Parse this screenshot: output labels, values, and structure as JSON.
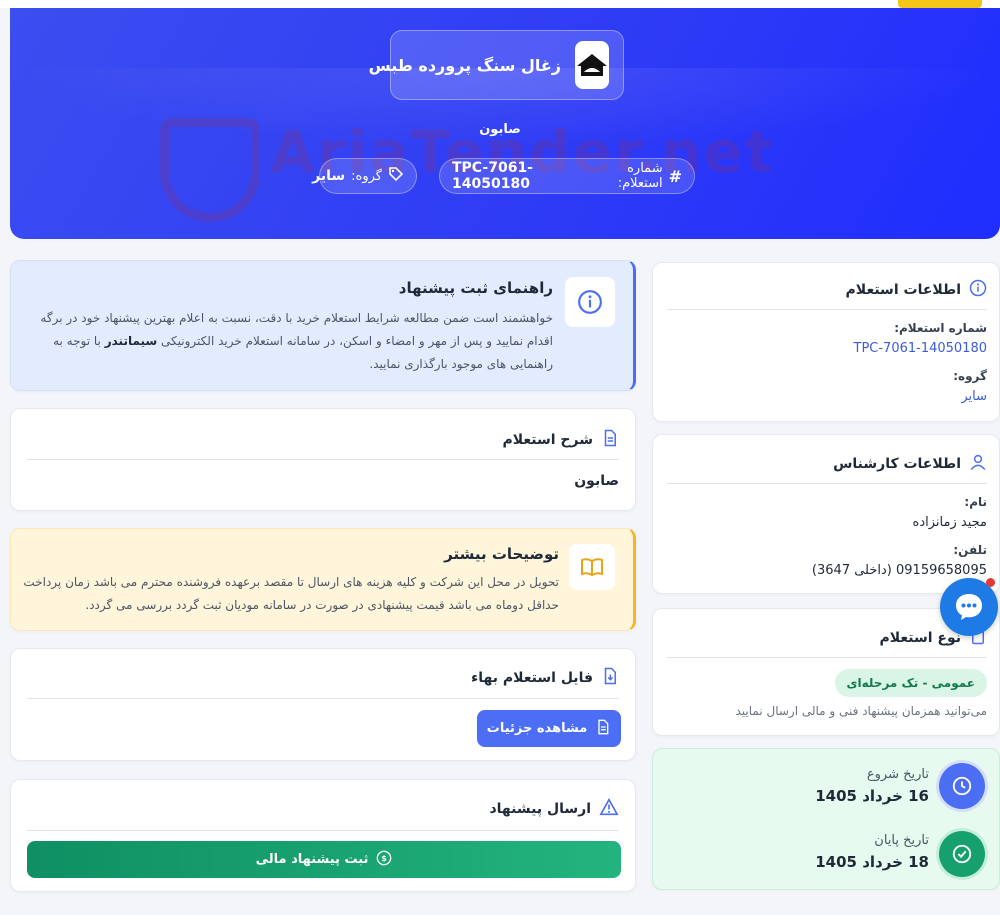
{
  "header": {
    "company_name": "زغال سنگ پرورده طبس",
    "subtitle": "صابون",
    "watermark": "AriaTender.net",
    "inquiry_number_label": "شماره استعلام:",
    "inquiry_number": "TPC-7061-14050180",
    "group_label": "گروه:",
    "group_value": "سایر"
  },
  "guide": {
    "title": "راهنمای ثبت پیشنهاد",
    "text_1": "خواهشمند است ضمن مطالعه شرایط استعلام خرید با دقت، نسبت به اعلام بهترین پیشنهاد خود در برگه اقدام نمایید و پس از مهر و امضاء و اسکن، در سامانه استعلام خرید الکترونیکی",
    "brand": "سیماتندر",
    "text_2": "با توجه به راهنمایی های موجود بارگذاری نمایید."
  },
  "description": {
    "title": "شرح استعلام",
    "value": "صابون"
  },
  "more_info": {
    "title": "توضیحات بیشتر",
    "text": "تحویل در محل این شرکت و کلیه هزینه های ارسال تا مقصد برعهده فروشنده محترم می باشد زمان پرداخت حداقل دوماه می باشد قیمت پیشنهادی در صورت در سامانه مودیان ثبت گردد بررسی می گردد."
  },
  "file": {
    "title": "فایل استعلام بهاء",
    "button_label": "مشاهده جزئیات"
  },
  "submit": {
    "title": "ارسال پیشنهاد",
    "button_label": "ثبت پیشنهاد مالی"
  },
  "inquiry_info": {
    "title": "اطلاعات استعلام",
    "number_label": "شماره استعلام:",
    "number_value": "TPC-7061-14050180",
    "group_label": "گروه:",
    "group_value": "سایر"
  },
  "expert_info": {
    "title": "اطلاعات کارشناس",
    "name_label": "نام:",
    "name_value": "مجید زمانزاده",
    "phone_label": "تلفن:",
    "phone_value": "09159658095 (داخلی 3647)"
  },
  "inquiry_type": {
    "title": "نوع استعلام",
    "badge": "عمومی - تک مرحله‌ای",
    "note": "می‌توانید همزمان پیشنهاد فنی و مالی ارسال نمایید"
  },
  "dates": {
    "start_label": "تاریخ شروع",
    "start_value": "16 خرداد 1405",
    "end_label": "تاریخ پایان",
    "end_value": "18 خرداد 1405"
  },
  "colors": {
    "primary": "#3b4ef0",
    "accent_blue": "#4c6ef5",
    "green": "#16a06e",
    "yellow": "#f5c518"
  }
}
